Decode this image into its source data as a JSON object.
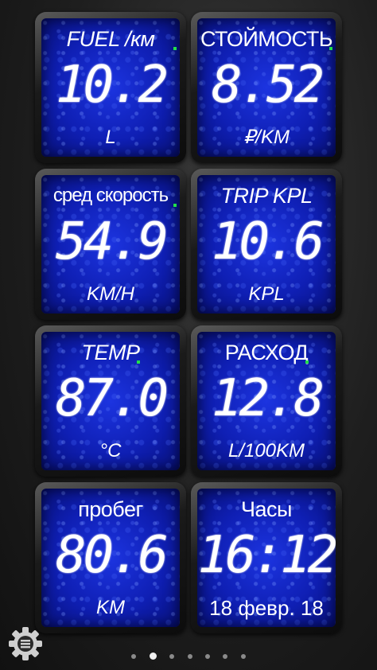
{
  "tiles": [
    {
      "title": "FUEL /км",
      "value": "10.2",
      "unit": "L"
    },
    {
      "title": "СТОЙМОСТЬ",
      "value": "8.52",
      "unit": "₽/KM"
    },
    {
      "title": "сред скорость",
      "value": "54.9",
      "unit": "KM/H"
    },
    {
      "title": "TRIP KPL",
      "value": "10.6",
      "unit": "KPL"
    },
    {
      "title": "TEMP",
      "value": "87.0",
      "unit": "°C"
    },
    {
      "title": "РАСХОД",
      "value": "12.8",
      "unit": "L/100KM"
    },
    {
      "title": "пробег",
      "value": "80.6",
      "unit": "KM"
    },
    {
      "title": "Часы",
      "value": "16:12",
      "unit": "18 февр. 18"
    }
  ],
  "pager": {
    "count": 7,
    "active_index": 1
  },
  "colors": {
    "screen": "#1a2fd8",
    "led": "#22e04a",
    "text": "#ffffff"
  },
  "settings_icon": "gear-menu-icon"
}
